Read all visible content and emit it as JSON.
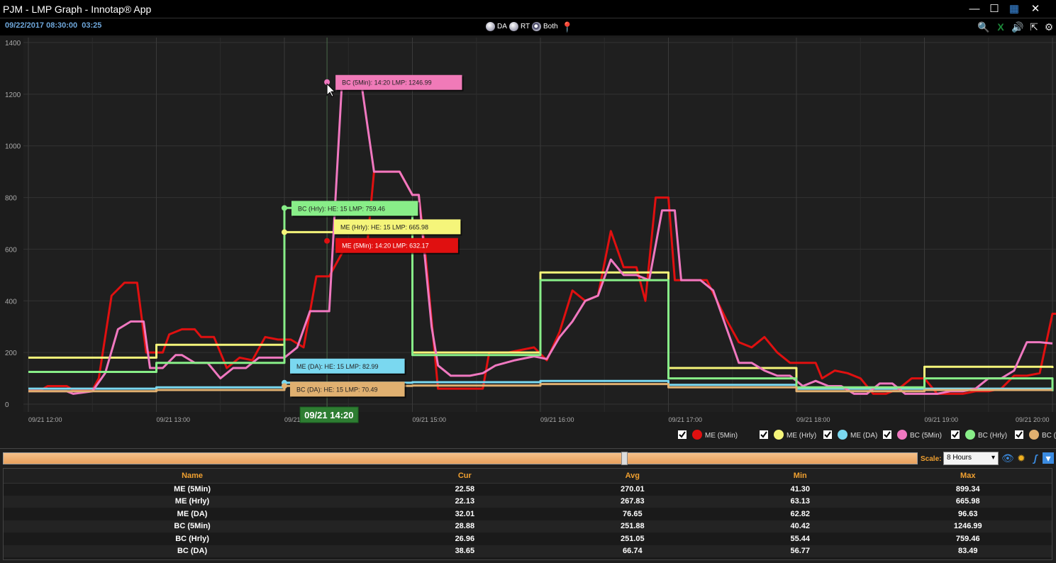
{
  "window": {
    "title": "PJM - LMP Graph - Innotap® App"
  },
  "toolbar": {
    "timestamp": "09/22/2017 08:30:00",
    "countdown": "03:25",
    "radios": [
      {
        "label": "DA",
        "selected": false
      },
      {
        "label": "RT",
        "selected": false
      },
      {
        "label": "Both",
        "selected": true
      }
    ]
  },
  "chart_data": {
    "type": "line",
    "ylim": [
      0,
      1400
    ],
    "y_ticks": [
      "0",
      "200",
      "400",
      "600",
      "800",
      "1000",
      "1200",
      "1400"
    ],
    "x_ticks": [
      "09/21 12:00",
      "09/21 13:00",
      "09/21 14:00",
      "09/21 15:00",
      "09/21 16:00",
      "09/21 17:00",
      "09/21 18:00",
      "09/21 19:00",
      "09/21 20:00"
    ],
    "x_unit": "hours after 09/21 12:00",
    "xlim": [
      0,
      8
    ],
    "cursor_label": "09/21 14:20",
    "cursor_x": 2.333,
    "series": [
      {
        "name": "ME (5Min)",
        "color": "#e01010",
        "style": "step",
        "points": [
          [
            0,
            55
          ],
          [
            0.1,
            55
          ],
          [
            0.15,
            70
          ],
          [
            0.3,
            70
          ],
          [
            0.35,
            55
          ],
          [
            0.5,
            55
          ],
          [
            0.55,
            100
          ],
          [
            0.65,
            420
          ],
          [
            0.75,
            470
          ],
          [
            0.85,
            470
          ],
          [
            0.92,
            200
          ],
          [
            1.05,
            200
          ],
          [
            1.1,
            270
          ],
          [
            1.2,
            290
          ],
          [
            1.3,
            290
          ],
          [
            1.35,
            260
          ],
          [
            1.45,
            260
          ],
          [
            1.55,
            140
          ],
          [
            1.65,
            180
          ],
          [
            1.75,
            170
          ],
          [
            1.85,
            260
          ],
          [
            1.95,
            250
          ],
          [
            2.05,
            250
          ],
          [
            2.15,
            220
          ],
          [
            2.25,
            495
          ],
          [
            2.35,
            495
          ],
          [
            2.5,
            630
          ],
          [
            2.6,
            630
          ],
          [
            2.65,
            632
          ],
          [
            2.7,
            900
          ],
          [
            2.8,
            900
          ],
          [
            2.9,
            900
          ],
          [
            3.0,
            810
          ],
          [
            3.05,
            810
          ],
          [
            3.1,
            590
          ],
          [
            3.2,
            60
          ],
          [
            3.3,
            60
          ],
          [
            3.55,
            60
          ],
          [
            3.6,
            200
          ],
          [
            3.75,
            200
          ],
          [
            3.95,
            220
          ],
          [
            4.05,
            170
          ],
          [
            4.15,
            280
          ],
          [
            4.25,
            440
          ],
          [
            4.35,
            400
          ],
          [
            4.45,
            420
          ],
          [
            4.55,
            670
          ],
          [
            4.65,
            530
          ],
          [
            4.75,
            530
          ],
          [
            4.82,
            400
          ],
          [
            4.9,
            800
          ],
          [
            5.0,
            800
          ],
          [
            5.05,
            480
          ],
          [
            5.2,
            480
          ],
          [
            5.3,
            480
          ],
          [
            5.45,
            330
          ],
          [
            5.55,
            240
          ],
          [
            5.65,
            220
          ],
          [
            5.75,
            260
          ],
          [
            5.85,
            200
          ],
          [
            5.95,
            160
          ],
          [
            6.05,
            160
          ],
          [
            6.15,
            160
          ],
          [
            6.2,
            100
          ],
          [
            6.3,
            130
          ],
          [
            6.4,
            120
          ],
          [
            6.5,
            100
          ],
          [
            6.6,
            40
          ],
          [
            6.7,
            40
          ],
          [
            6.8,
            60
          ],
          [
            6.9,
            100
          ],
          [
            7.0,
            100
          ],
          [
            7.1,
            40
          ],
          [
            7.3,
            40
          ],
          [
            7.4,
            50
          ],
          [
            7.5,
            50
          ],
          [
            7.6,
            60
          ],
          [
            7.7,
            110
          ],
          [
            7.8,
            110
          ],
          [
            7.9,
            120
          ],
          [
            8.0,
            350
          ],
          [
            8.1,
            350
          ],
          [
            8.2,
            350
          ],
          [
            8.25,
            330
          ]
        ]
      },
      {
        "name": "ME (Hrly)",
        "color": "#f5f57a",
        "style": "step",
        "points": [
          [
            0,
            180
          ],
          [
            1,
            180
          ],
          [
            1,
            230
          ],
          [
            2,
            230
          ],
          [
            2,
            665.98
          ],
          [
            3,
            665.98
          ],
          [
            3,
            200
          ],
          [
            4,
            200
          ],
          [
            4,
            510
          ],
          [
            5,
            510
          ],
          [
            5,
            140
          ],
          [
            6,
            140
          ],
          [
            6,
            60
          ],
          [
            7,
            60
          ],
          [
            7,
            145
          ],
          [
            8,
            145
          ],
          [
            8,
            140
          ]
        ]
      },
      {
        "name": "ME (DA)",
        "color": "#7ad8f0",
        "style": "step",
        "points": [
          [
            0,
            60
          ],
          [
            1,
            60
          ],
          [
            1,
            65
          ],
          [
            2,
            65
          ],
          [
            2,
            82.99
          ],
          [
            3,
            82.99
          ],
          [
            3,
            85
          ],
          [
            4,
            85
          ],
          [
            4,
            90
          ],
          [
            5,
            90
          ],
          [
            5,
            75
          ],
          [
            6,
            75
          ],
          [
            6,
            60
          ],
          [
            7,
            60
          ],
          [
            7,
            60
          ],
          [
            8,
            60
          ]
        ]
      },
      {
        "name": "BC (5Min)",
        "color": "#f078c0",
        "style": "line",
        "points": [
          [
            0,
            50
          ],
          [
            0.3,
            50
          ],
          [
            0.35,
            40
          ],
          [
            0.5,
            50
          ],
          [
            0.6,
            120
          ],
          [
            0.7,
            290
          ],
          [
            0.8,
            320
          ],
          [
            0.9,
            320
          ],
          [
            0.95,
            140
          ],
          [
            1.05,
            140
          ],
          [
            1.15,
            190
          ],
          [
            1.2,
            190
          ],
          [
            1.3,
            160
          ],
          [
            1.4,
            160
          ],
          [
            1.5,
            100
          ],
          [
            1.6,
            140
          ],
          [
            1.7,
            140
          ],
          [
            1.8,
            180
          ],
          [
            1.9,
            180
          ],
          [
            2.0,
            180
          ],
          [
            2.1,
            220
          ],
          [
            2.2,
            360
          ],
          [
            2.35,
            360
          ],
          [
            2.45,
            1246.99
          ],
          [
            2.55,
            1246.99
          ],
          [
            2.6,
            1246.99
          ],
          [
            2.7,
            900
          ],
          [
            2.8,
            900
          ],
          [
            2.9,
            900
          ],
          [
            3.0,
            810
          ],
          [
            3.05,
            810
          ],
          [
            3.15,
            300
          ],
          [
            3.2,
            150
          ],
          [
            3.3,
            110
          ],
          [
            3.45,
            110
          ],
          [
            3.55,
            120
          ],
          [
            3.65,
            150
          ],
          [
            3.8,
            170
          ],
          [
            3.95,
            185
          ],
          [
            4.05,
            175
          ],
          [
            4.15,
            260
          ],
          [
            4.25,
            320
          ],
          [
            4.35,
            400
          ],
          [
            4.45,
            420
          ],
          [
            4.55,
            560
          ],
          [
            4.65,
            500
          ],
          [
            4.75,
            500
          ],
          [
            4.85,
            480
          ],
          [
            4.95,
            750
          ],
          [
            5.05,
            750
          ],
          [
            5.1,
            480
          ],
          [
            5.25,
            480
          ],
          [
            5.35,
            440
          ],
          [
            5.45,
            300
          ],
          [
            5.55,
            160
          ],
          [
            5.65,
            160
          ],
          [
            5.75,
            130
          ],
          [
            5.85,
            110
          ],
          [
            5.95,
            110
          ],
          [
            6.05,
            70
          ],
          [
            6.15,
            90
          ],
          [
            6.25,
            70
          ],
          [
            6.35,
            70
          ],
          [
            6.45,
            40
          ],
          [
            6.55,
            40
          ],
          [
            6.65,
            80
          ],
          [
            6.75,
            80
          ],
          [
            6.85,
            40
          ],
          [
            7.0,
            40
          ],
          [
            7.1,
            40
          ],
          [
            7.2,
            50
          ],
          [
            7.3,
            50
          ],
          [
            7.4,
            60
          ],
          [
            7.5,
            100
          ],
          [
            7.6,
            100
          ],
          [
            7.7,
            130
          ],
          [
            7.8,
            240
          ],
          [
            7.9,
            240
          ],
          [
            8.0,
            235
          ]
        ]
      },
      {
        "name": "BC (Hrly)",
        "color": "#88ee88",
        "style": "step",
        "points": [
          [
            0,
            125
          ],
          [
            1,
            125
          ],
          [
            1,
            160
          ],
          [
            2,
            160
          ],
          [
            2,
            759.46
          ],
          [
            3,
            759.46
          ],
          [
            3,
            190
          ],
          [
            4,
            190
          ],
          [
            4,
            480
          ],
          [
            5,
            480
          ],
          [
            5,
            100
          ],
          [
            6,
            100
          ],
          [
            6,
            65
          ],
          [
            7,
            65
          ],
          [
            7,
            100
          ],
          [
            8,
            100
          ],
          [
            8,
            50
          ]
        ]
      },
      {
        "name": "BC (DA)",
        "color": "#e0b070",
        "style": "step",
        "points": [
          [
            0,
            50
          ],
          [
            1,
            50
          ],
          [
            1,
            55
          ],
          [
            2,
            55
          ],
          [
            2,
            70.49
          ],
          [
            3,
            70.49
          ],
          [
            3,
            72
          ],
          [
            4,
            72
          ],
          [
            4,
            78
          ],
          [
            5,
            78
          ],
          [
            5,
            65
          ],
          [
            6,
            65
          ],
          [
            6,
            50
          ],
          [
            7,
            50
          ],
          [
            7,
            55
          ],
          [
            8,
            55
          ]
        ]
      }
    ],
    "tooltips": [
      {
        "text": "BC (5Min): 14:20 LMP: 1246.99",
        "series": 3,
        "x": 2.333,
        "y": 1246.99
      },
      {
        "text": "BC (Hrly): HE: 15 LMP: 759.46",
        "series": 4,
        "x": 2.0,
        "y": 759.46
      },
      {
        "text": "ME (Hrly): HE: 15 LMP: 665.98",
        "series": 1,
        "x": 2.0,
        "y": 665.98
      },
      {
        "text": "ME (5Min): 14:20 LMP: 632.17",
        "series": 0,
        "x": 2.333,
        "y": 632.17
      },
      {
        "text": "ME (DA): HE: 15 LMP: 82.99",
        "series": 2,
        "x": 2.0,
        "y": 82.99
      },
      {
        "text": "BC (DA): HE: 15 LMP: 70.49",
        "series": 5,
        "x": 2.0,
        "y": 70.49
      }
    ]
  },
  "legend": [
    "ME (5Min)",
    "ME (Hrly)",
    "ME (DA)",
    "BC (5Min)",
    "BC (Hrly)",
    "BC (DA)"
  ],
  "scale": {
    "label": "Scale:",
    "value": "8 Hours"
  },
  "table": {
    "headers": [
      "Name",
      "Cur",
      "Avg",
      "Min",
      "Max"
    ],
    "rows": [
      [
        "ME (5Min)",
        "22.58",
        "270.01",
        "41.30",
        "899.34"
      ],
      [
        "ME (Hrly)",
        "22.13",
        "267.83",
        "63.13",
        "665.98"
      ],
      [
        "ME (DA)",
        "32.01",
        "76.65",
        "62.82",
        "96.63"
      ],
      [
        "BC (5Min)",
        "28.88",
        "251.88",
        "40.42",
        "1246.99"
      ],
      [
        "BC (Hrly)",
        "26.96",
        "251.05",
        "55.44",
        "759.46"
      ],
      [
        "BC (DA)",
        "38.65",
        "66.74",
        "56.77",
        "83.49"
      ]
    ]
  }
}
